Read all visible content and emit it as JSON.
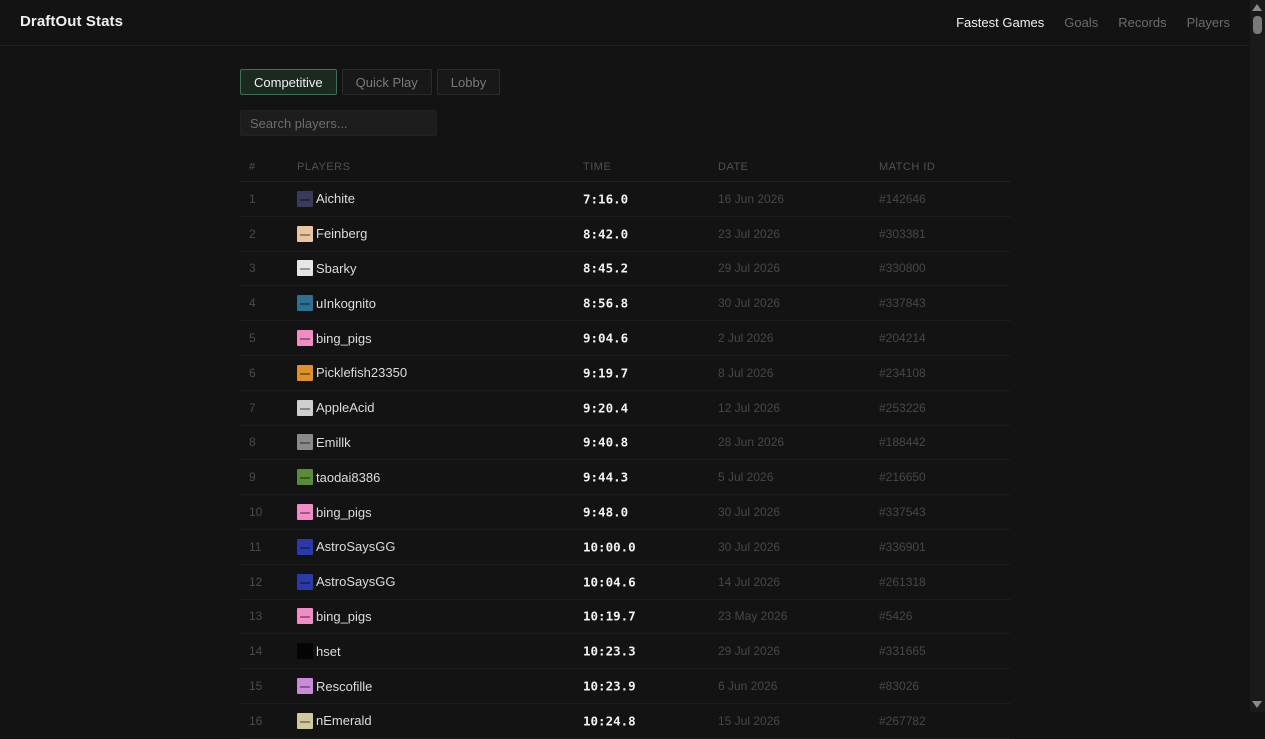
{
  "brand": "DraftOut Stats",
  "nav": [
    {
      "label": "Fastest Games",
      "active": true
    },
    {
      "label": "Goals",
      "active": false
    },
    {
      "label": "Records",
      "active": false
    },
    {
      "label": "Players",
      "active": false
    }
  ],
  "tabs": [
    {
      "label": "Competitive",
      "active": true
    },
    {
      "label": "Quick Play",
      "active": false
    },
    {
      "label": "Lobby",
      "active": false
    }
  ],
  "search": {
    "placeholder": "Search players...",
    "value": ""
  },
  "table": {
    "headers": {
      "rank": "#",
      "player": "PLAYERS",
      "time": "TIME",
      "date": "DATE",
      "match": "MATCH ID"
    },
    "rows": [
      {
        "rank": "1",
        "player": "Aichite",
        "time": "7:16.0",
        "date": "16 Jun 2026",
        "match": "#142646",
        "avatar_color": "#3a3a5a"
      },
      {
        "rank": "2",
        "player": "Feinberg",
        "time": "8:42.0",
        "date": "23 Jul 2026",
        "match": "#303381",
        "avatar_color": "#e8c6a0"
      },
      {
        "rank": "3",
        "player": "Sbarky",
        "time": "8:45.2",
        "date": "29 Jul 2026",
        "match": "#330800",
        "avatar_color": "#e6e6e6"
      },
      {
        "rank": "4",
        "player": "uInkognito",
        "time": "8:56.8",
        "date": "30 Jul 2026",
        "match": "#337843",
        "avatar_color": "#2f6f8f"
      },
      {
        "rank": "5",
        "player": "bing_pigs",
        "time": "9:04.6",
        "date": "2 Jul 2026",
        "match": "#204214",
        "avatar_color": "#f28cc6"
      },
      {
        "rank": "6",
        "player": "Picklefish23350",
        "time": "9:19.7",
        "date": "8 Jul 2026",
        "match": "#234108",
        "avatar_color": "#e0902a"
      },
      {
        "rank": "7",
        "player": "AppleAcid",
        "time": "9:20.4",
        "date": "12 Jul 2026",
        "match": "#253226",
        "avatar_color": "#cfcfcf"
      },
      {
        "rank": "8",
        "player": "Emillk",
        "time": "9:40.8",
        "date": "28 Jun 2026",
        "match": "#188442",
        "avatar_color": "#8a8a8a"
      },
      {
        "rank": "9",
        "player": "taodai8386",
        "time": "9:44.3",
        "date": "5 Jul 2026",
        "match": "#216650",
        "avatar_color": "#5a8a3a"
      },
      {
        "rank": "10",
        "player": "bing_pigs",
        "time": "9:48.0",
        "date": "30 Jul 2026",
        "match": "#337543",
        "avatar_color": "#f28cc6"
      },
      {
        "rank": "11",
        "player": "AstroSaysGG",
        "time": "10:00.0",
        "date": "30 Jul 2026",
        "match": "#336901",
        "avatar_color": "#2a3aa8"
      },
      {
        "rank": "12",
        "player": "AstroSaysGG",
        "time": "10:04.6",
        "date": "14 Jul 2026",
        "match": "#261318",
        "avatar_color": "#2a3aa8"
      },
      {
        "rank": "13",
        "player": "bing_pigs",
        "time": "10:19.7",
        "date": "23 May 2026",
        "match": "#5426",
        "avatar_color": "#f28cc6"
      },
      {
        "rank": "14",
        "player": "hset",
        "time": "10:23.3",
        "date": "29 Jul 2026",
        "match": "#331665",
        "avatar_color": "#050505"
      },
      {
        "rank": "15",
        "player": "Rescofille",
        "time": "10:23.9",
        "date": "6 Jun 2026",
        "match": "#83026",
        "avatar_color": "#c98ad8"
      },
      {
        "rank": "16",
        "player": "nEmerald",
        "time": "10:24.8",
        "date": "15 Jul 2026",
        "match": "#267782",
        "avatar_color": "#cfc9a0"
      }
    ]
  }
}
